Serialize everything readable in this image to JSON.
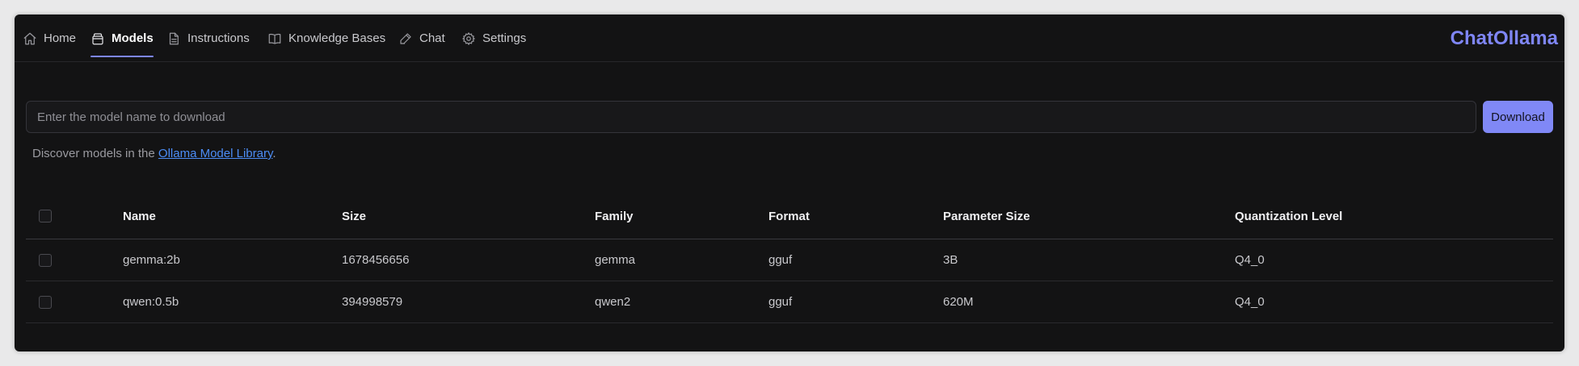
{
  "app": {
    "brand": "ChatOllama",
    "accent_color": "#7f86f5"
  },
  "nav": {
    "items": [
      {
        "label": "Home",
        "icon": "home-icon",
        "active": false
      },
      {
        "label": "Models",
        "icon": "models-icon",
        "active": true
      },
      {
        "label": "Instructions",
        "icon": "document-icon",
        "active": false
      },
      {
        "label": "Knowledge Bases",
        "icon": "book-icon",
        "active": false
      },
      {
        "label": "Chat",
        "icon": "edit-icon",
        "active": false
      },
      {
        "label": "Settings",
        "icon": "gear-icon",
        "active": false
      }
    ]
  },
  "download": {
    "placeholder": "Enter the model name to download",
    "value": "",
    "button_label": "Download"
  },
  "discover": {
    "prefix": "Discover models in the ",
    "link_text": "Ollama Model Library",
    "suffix": "."
  },
  "table": {
    "columns": [
      "Name",
      "Size",
      "Family",
      "Format",
      "Parameter Size",
      "Quantization Level"
    ],
    "rows": [
      {
        "name": "gemma:2b",
        "size": "1678456656",
        "family": "gemma",
        "format": "gguf",
        "parameter_size": "3B",
        "quantization": "Q4_0"
      },
      {
        "name": "qwen:0.5b",
        "size": "394998579",
        "family": "qwen2",
        "format": "gguf",
        "parameter_size": "620M",
        "quantization": "Q4_0"
      }
    ]
  }
}
